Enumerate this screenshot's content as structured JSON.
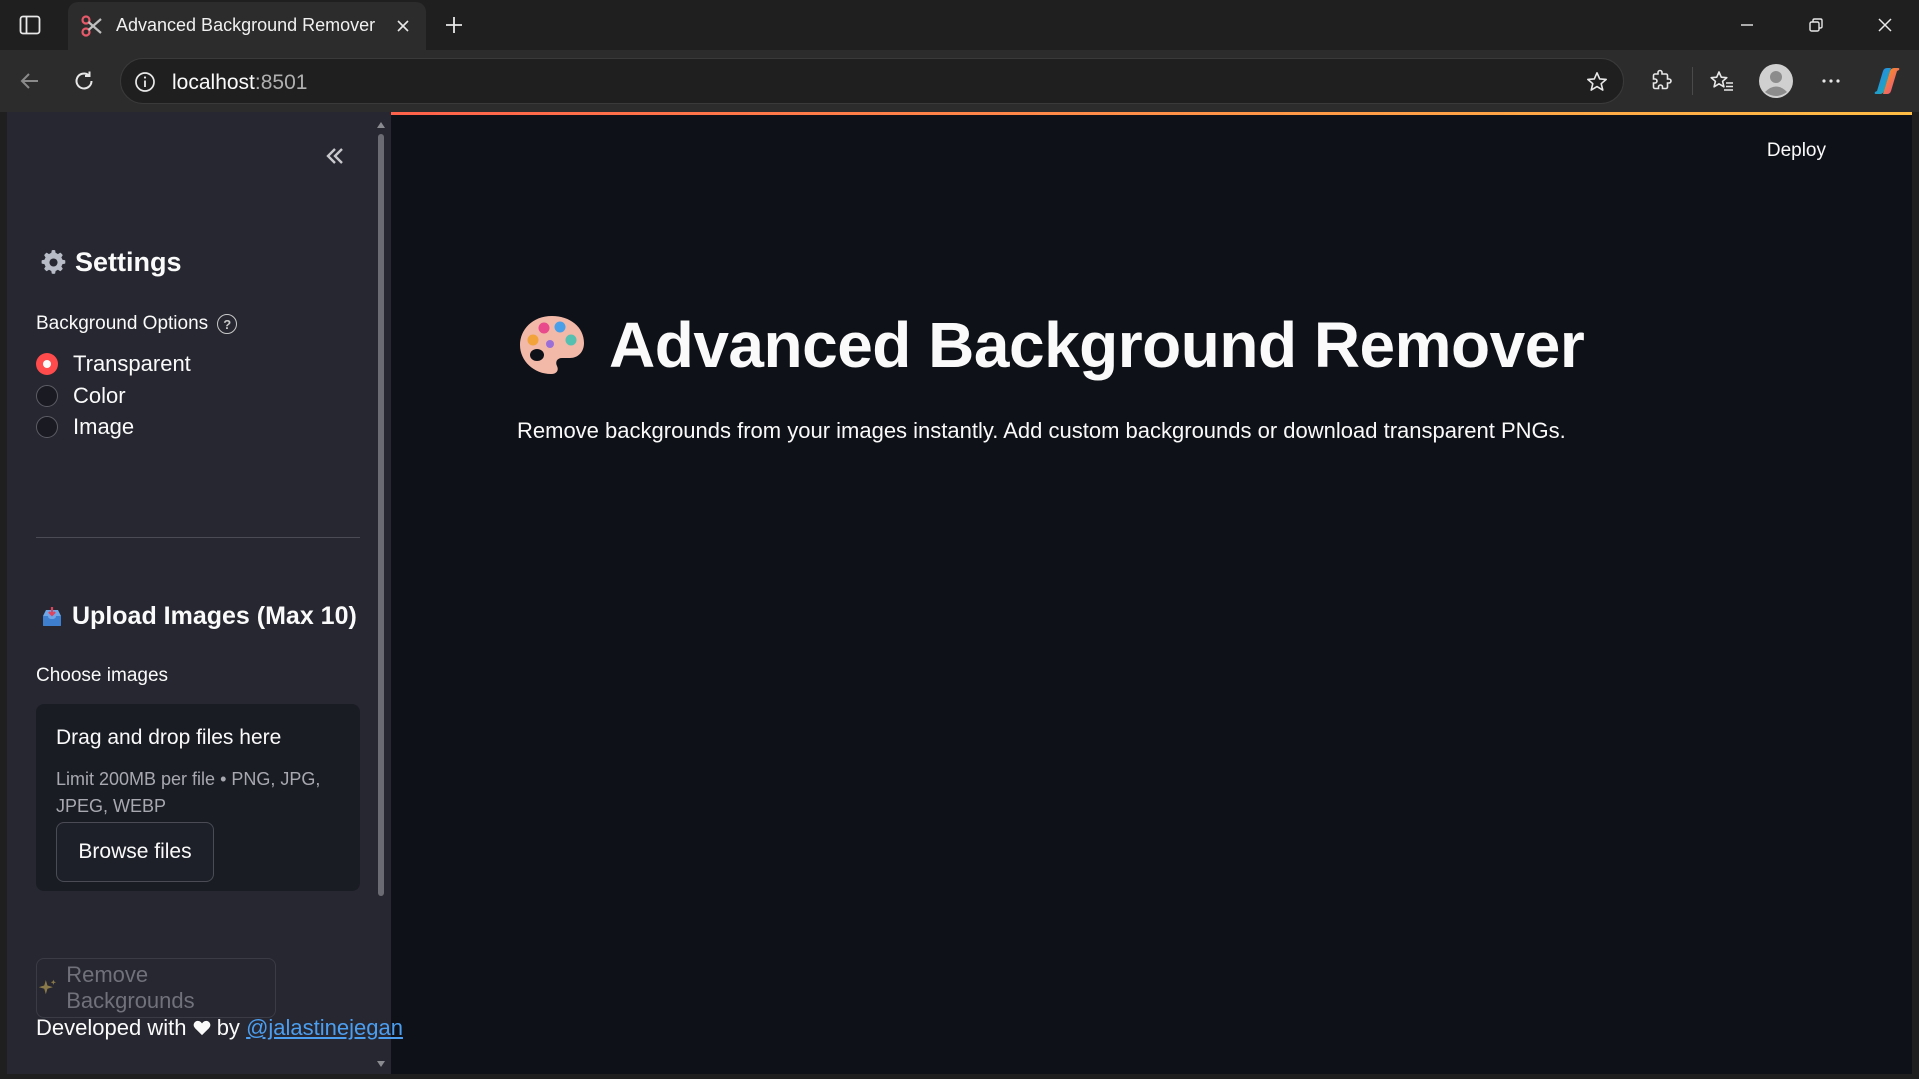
{
  "browser": {
    "tab_title": "Advanced Background Remover",
    "url_host": "localhost",
    "url_port": ":8501"
  },
  "sidebar": {
    "settings_title": "Settings",
    "background_options_label": "Background Options",
    "help_glyph": "?",
    "radio_options": [
      {
        "label": "Transparent",
        "selected": true
      },
      {
        "label": "Color",
        "selected": false
      },
      {
        "label": "Image",
        "selected": false
      }
    ],
    "upload_title": "Upload Images (Max 10)",
    "choose_label": "Choose images",
    "dropzone": {
      "title": "Drag and drop files here",
      "limit": "Limit 200MB per file • PNG, JPG, JPEG, WEBP",
      "browse_label": "Browse files"
    },
    "remove_button_label": "Remove Backgrounds",
    "developed_prefix": "Developed with",
    "developed_by": "by",
    "author_link": "@jalastinejegan"
  },
  "header": {
    "deploy_label": "Deploy"
  },
  "main": {
    "title": "Advanced Background Remover",
    "subtitle": "Remove backgrounds from your images instantly. Add custom backgrounds or download transparent PNGs."
  },
  "colors": {
    "accent": "#ff4b4b",
    "page_bg": "#0e1117",
    "sidebar_bg": "#262730",
    "link": "#4c9ef0"
  },
  "icons": [
    "sidebar-toggle-icon",
    "scissors-icon",
    "close-icon",
    "plus-icon",
    "minimize-icon",
    "restore-icon",
    "back-icon",
    "reload-icon",
    "info-icon",
    "star-icon",
    "extensions-icon",
    "favorites-icon",
    "profile-icon",
    "more-icon",
    "copilot-icon",
    "double-chevron-left-icon",
    "gear-icon",
    "help-icon",
    "inbox-tray-icon",
    "sparkles-icon",
    "heart-icon",
    "palette-icon"
  ]
}
